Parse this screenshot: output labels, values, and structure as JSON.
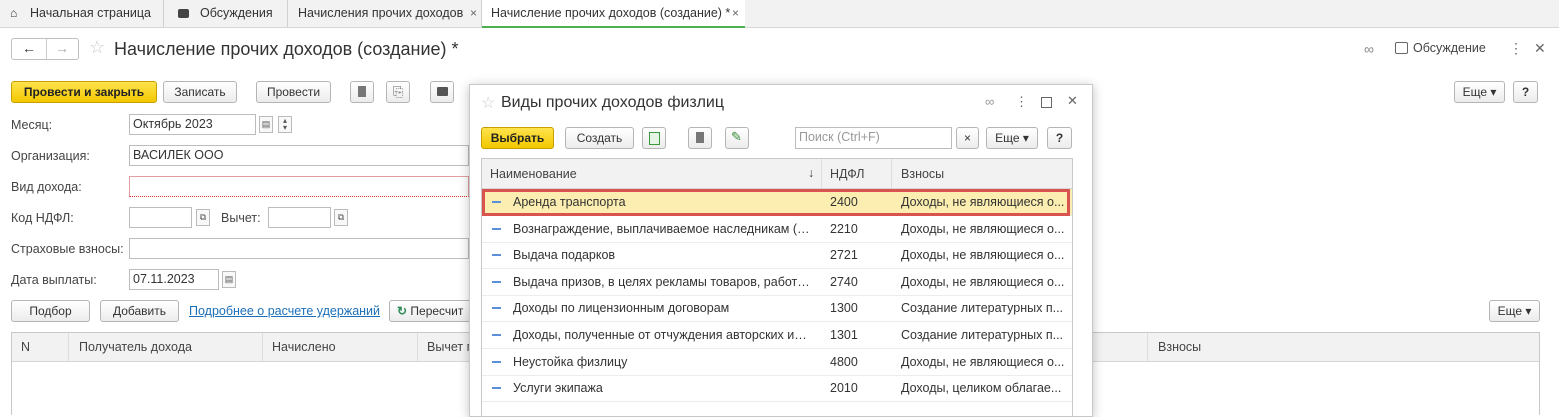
{
  "tabs": [
    {
      "label": "Начальная страница",
      "icon": "home-icon"
    },
    {
      "label": "Обсуждения",
      "icon": "chat-icon"
    },
    {
      "label": "Начисления прочих доходов",
      "close": "×"
    },
    {
      "label": "Начисление прочих доходов (создание) *",
      "close": "×"
    }
  ],
  "header": {
    "title": "Начисление прочих доходов (создание) *",
    "discussion": "Обсуждение"
  },
  "toolbar": {
    "post_close": "Провести и закрыть",
    "save": "Записать",
    "post": "Провести",
    "more": "Еще",
    "help": "?"
  },
  "form": {
    "month_label": "Месяц:",
    "month_value": "Октябрь 2023",
    "org_label": "Организация:",
    "org_value": "ВАСИЛЕК ООО",
    "income_type_label": "Вид дохода:",
    "income_type_value": "",
    "ndfl_code_label": "Код НДФЛ:",
    "deduction_label": "Вычет:",
    "insurance_label": "Страховые взносы:",
    "pay_date_label": "Дата выплаты:",
    "pay_date_value": "07.11.2023"
  },
  "grid_toolbar": {
    "pick": "Подбор",
    "add": "Добавить",
    "details_link": "Подробнее о расчете удержаний",
    "recalc": "Пересчит",
    "more": "Еще"
  },
  "grid": {
    "columns": [
      "N",
      "Получатель дохода",
      "Начислено",
      "Вычет г",
      "Взносы"
    ]
  },
  "dialog": {
    "title": "Виды прочих доходов физлиц",
    "select": "Выбрать",
    "create": "Создать",
    "search_placeholder": "Поиск (Ctrl+F)",
    "search_clear": "×",
    "more": "Еще",
    "help": "?",
    "columns": {
      "name": "Наименование",
      "sort": "↓",
      "ndfl": "НДФЛ",
      "contrib": "Взносы"
    },
    "rows": [
      {
        "name": "Аренда транспорта",
        "ndfl": "2400",
        "contrib": "Доходы, не являющиеся о..."
      },
      {
        "name": "Вознаграждение, выплачиваемое наследникам (пр...",
        "ndfl": "2210",
        "contrib": "Доходы, не являющиеся о..."
      },
      {
        "name": "Выдача подарков",
        "ndfl": "2721",
        "contrib": "Доходы, не являющиеся о..."
      },
      {
        "name": "Выдача призов, в целях рекламы товаров, работ и ...",
        "ndfl": "2740",
        "contrib": "Доходы, не являющиеся о..."
      },
      {
        "name": "Доходы по лицензионным договорам",
        "ndfl": "1300",
        "contrib": "Создание литературных п..."
      },
      {
        "name": "Доходы, полученные от отчуждения авторских или ...",
        "ndfl": "1301",
        "contrib": "Создание литературных п..."
      },
      {
        "name": "Неустойка физлицу",
        "ndfl": "4800",
        "contrib": "Доходы, не являющиеся о..."
      },
      {
        "name": "Услуги экипажа",
        "ndfl": "2010",
        "contrib": "Доходы, целиком облагае..."
      }
    ]
  },
  "colors": {
    "accent_yellow": "#f3c800",
    "selection_border": "#d9534f",
    "active_tab": "#4caf50",
    "link": "#1c6fb8"
  }
}
